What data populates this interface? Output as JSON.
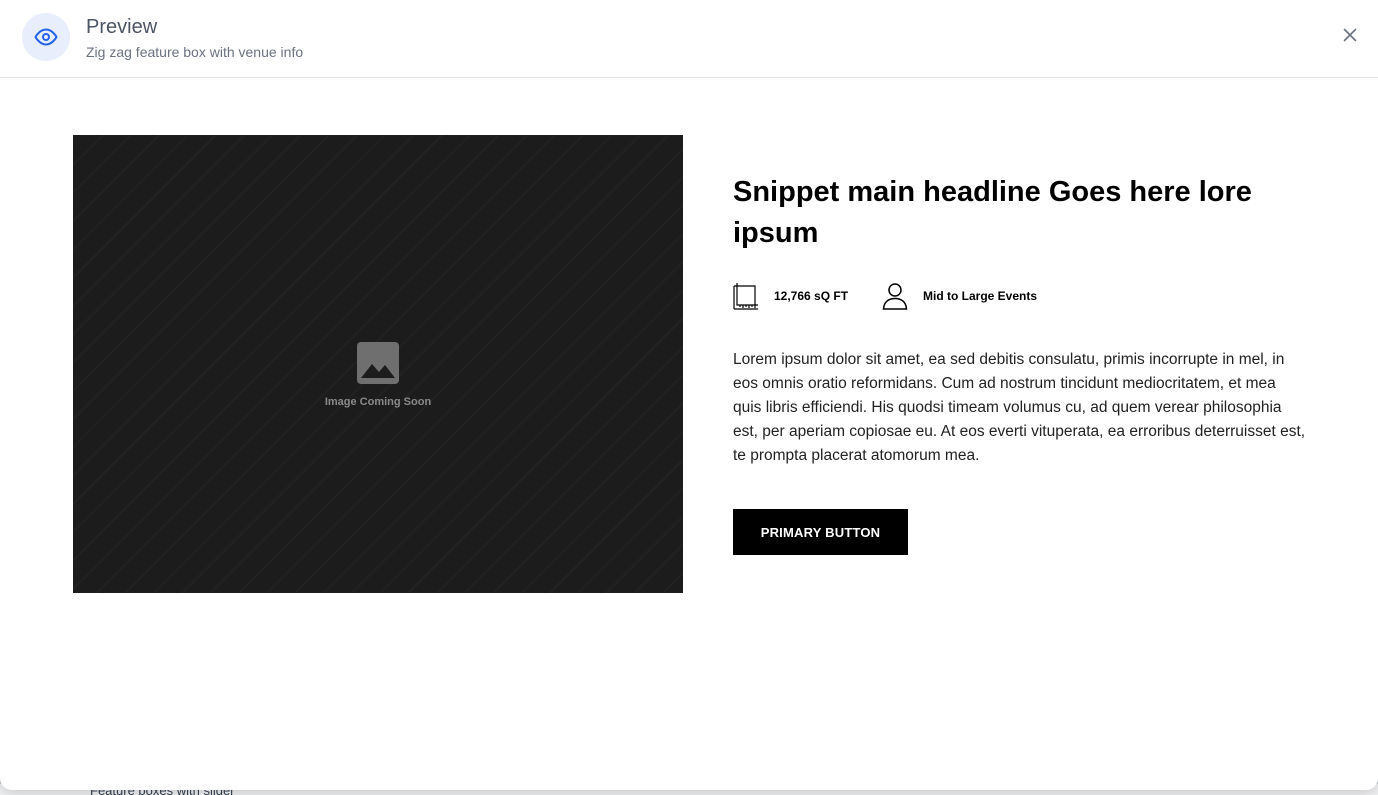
{
  "background_page": {
    "visible_row_text": "Feature boxes with slider"
  },
  "modal": {
    "title": "Preview",
    "subtitle": "Zig zag feature box with venue info",
    "icons": {
      "header": "eye-icon",
      "close": "close-icon"
    },
    "accent_color": "#2563eb"
  },
  "snippet": {
    "image_placeholder_label": "Image Coming Soon",
    "headline": "Snippet main headline Goes here lore ipsum",
    "features": [
      {
        "icon": "floor-area-icon",
        "label": "12,766 sQ FT"
      },
      {
        "icon": "person-icon",
        "label": "Mid to Large Events"
      }
    ],
    "body": "Lorem ipsum dolor sit amet, ea sed debitis consulatu, primis incorrupte in mel, in eos omnis oratio reformidans. Cum ad nostrum tincidunt mediocritatem, et mea quis libris efficiendi. His quodsi timeam volumus cu, ad quem verear philosophia est, per aperiam copiosae eu. At eos everti vituperata, ea erroribus deterruisset est, te prompta placerat atomorum mea.",
    "primary_button": "PRIMARY BUTTON"
  }
}
